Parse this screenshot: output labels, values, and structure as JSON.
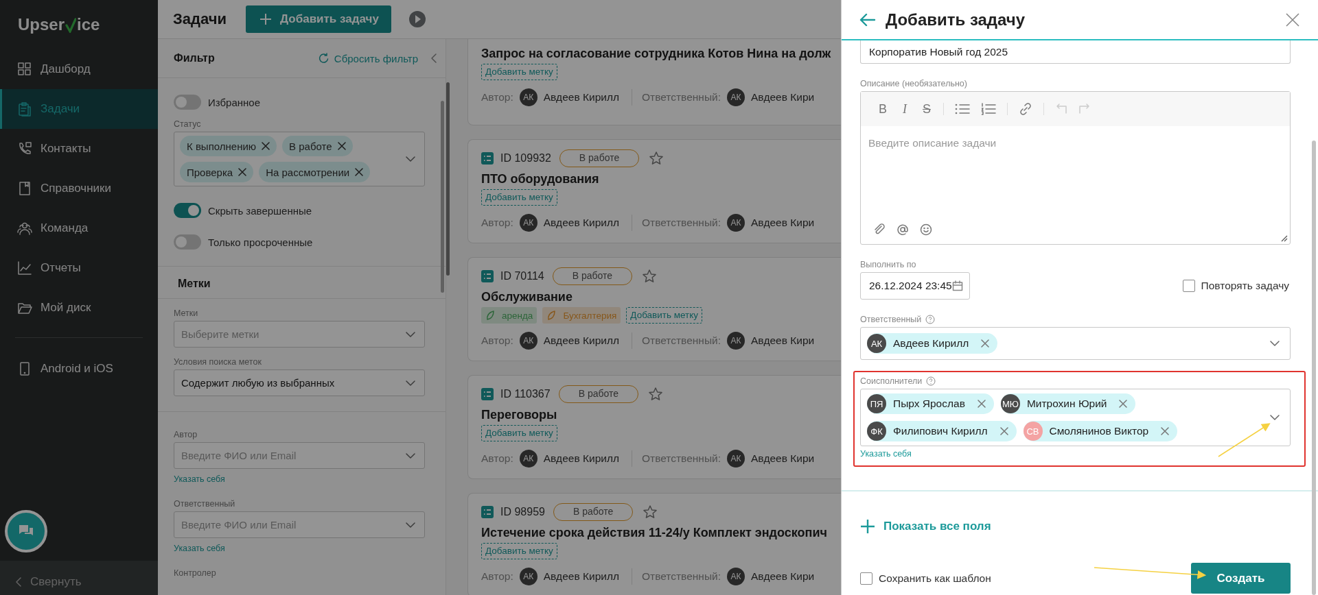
{
  "sidebar": {
    "logo": {
      "text_before": "Upser",
      "text_after": "ice"
    },
    "groups": [
      [
        {
          "label": "Дашборд",
          "selected": false
        },
        {
          "label": "Задачи",
          "selected": true
        },
        {
          "label": "Контакты",
          "selected": false
        },
        {
          "label": "Справочники",
          "selected": false
        },
        {
          "label": "Команда",
          "selected": false
        },
        {
          "label": "Отчеты",
          "selected": false
        },
        {
          "label": "Мой диск",
          "selected": false
        }
      ],
      [
        {
          "label": "Android и iOS",
          "selected": false
        }
      ]
    ],
    "collapse": "Свернуть"
  },
  "header": {
    "title": "Задачи",
    "add_button": "Добавить задачу"
  },
  "filter": {
    "title": "Фильтр",
    "reset": "Сбросить фильтр",
    "favorites": {
      "label": "Избранное",
      "on": false
    },
    "status": {
      "label": "Статус",
      "chips": [
        "К выполнению",
        "В работе",
        "Проверка",
        "На рассмотрении"
      ]
    },
    "hide_done": {
      "label": "Скрыть завершенные",
      "on": true
    },
    "overdue": {
      "label": "Только просроченные",
      "on": false
    },
    "tags_section": "Метки",
    "tag_fields": [
      {
        "label": "Метки",
        "placeholder": "Выберите метки"
      },
      {
        "label": "Условия поиска меток",
        "value": "Содержит любую из выбранных"
      }
    ],
    "people": [
      {
        "label": "Автор",
        "placeholder": "Введите ФИО или Email",
        "self_link": "Указать себя"
      },
      {
        "label": "Ответственный",
        "placeholder": "Введите ФИО или Email",
        "self_link": "Указать себя"
      }
    ],
    "last_label": "Контролер"
  },
  "tasks": [
    {
      "title": "Запрос на согласование сотрудника Котов Нина на долж",
      "add_tag": "Добавить метку",
      "author_label": "Автор:",
      "author": {
        "initials": "АК",
        "name": "Авдеев Кирилл"
      },
      "owner_label": "Ответственный:",
      "owner": {
        "initials": "АК",
        "name": "Авдеев Кири"
      }
    },
    {
      "id": "ID 109932",
      "status": "В работе",
      "starred": false,
      "title": "ПТО оборудования",
      "add_tag": "Добавить метку",
      "author_label": "Автор:",
      "author": {
        "initials": "АК",
        "name": "Авдеев Кирилл"
      },
      "owner_label": "Ответственный:",
      "owner": {
        "initials": "АК",
        "name": "Авдеев Кири"
      }
    },
    {
      "id": "ID 70114",
      "status": "В работе",
      "starred": false,
      "title": "Обслуживание",
      "tags": [
        {
          "label": "аренда",
          "color": "#2c6539"
        },
        {
          "label": "Бухгалтерия",
          "color": "#87571b"
        }
      ],
      "add_tag": "Добавить метку",
      "author_label": "Автор:",
      "author": {
        "initials": "АК",
        "name": "Авдеев Кирилл"
      },
      "owner_label": "Ответственный:",
      "owner": {
        "initials": "АК",
        "name": "Авдеев Кири"
      }
    },
    {
      "id": "ID 110367",
      "status": "В работе",
      "starred": false,
      "title": "Переговоры",
      "add_tag": "Добавить метку",
      "author_label": "Автор:",
      "author": {
        "initials": "АК",
        "name": "Авдеев Кирилл"
      },
      "owner_label": "Ответственный:",
      "owner": {
        "initials": "АК",
        "name": "Авдеев Кири"
      }
    },
    {
      "id": "ID 98959",
      "status": "В работе",
      "starred": false,
      "title": "Истечение срока действия 11-24/у Комплект эндоскопич",
      "add_tag": "Добавить метку",
      "author_label": "Автор:",
      "author": {
        "initials": "АК",
        "name": "Авдеев Кирилл"
      },
      "owner_label": "Ответственный:",
      "owner": {
        "initials": "АК",
        "name": "Авдеев Кири"
      }
    }
  ],
  "drawer": {
    "title": "Добавить задачу",
    "name_value": "Корпоратив Новый год 2025",
    "description": {
      "label": "Описание (необязательно)",
      "format_keys": [
        "B",
        "I",
        "S"
      ],
      "undo_redo_disabled": true,
      "placeholder": "Введите описание задачи"
    },
    "due": {
      "label": "Выполнить по",
      "value": "26.12.2024 23:45"
    },
    "repeat": {
      "label": "Повторять задачу",
      "checked": false
    },
    "owner": {
      "label": "Ответственный",
      "people": [
        {
          "initials": "АК",
          "name": "Авдеев Кирилл",
          "color": "#4a4a4a"
        }
      ]
    },
    "coexecutors": {
      "label": "Соисполнители",
      "highlighted": true,
      "people": [
        {
          "initials": "ПЯ",
          "name": "Пырх Ярослав",
          "color": "#4a4a4a"
        },
        {
          "initials": "МЮ",
          "name": "Митрохин Юрий",
          "color": "#4a4a4a"
        },
        {
          "initials": "ФК",
          "name": "Филипович Кирилл",
          "color": "#4a4a4a"
        },
        {
          "initials": "СВ",
          "name": "Смолянинов Виктор",
          "color": "#f4a3a3"
        }
      ],
      "self_link": "Указать себя"
    },
    "show_all": "Показать все поля",
    "save_template": {
      "label": "Сохранить как шаблон",
      "checked": false
    },
    "create": "Создать"
  }
}
